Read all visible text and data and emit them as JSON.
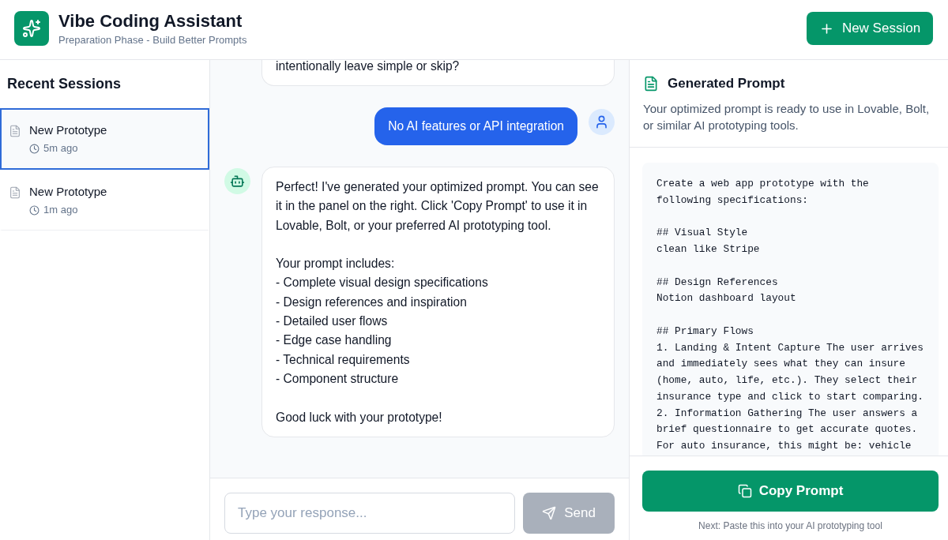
{
  "header": {
    "title": "Vibe Coding Assistant",
    "subtitle": "Preparation Phase - Build Better Prompts",
    "new_session_button": "New Session"
  },
  "sidebar": {
    "heading": "Recent Sessions",
    "sessions": [
      {
        "title": "New Prototype",
        "time": "5m ago",
        "selected": true
      },
      {
        "title": "New Prototype",
        "time": "1m ago",
        "selected": false
      }
    ]
  },
  "chat": {
    "messages": [
      {
        "kind": "assistant",
        "clipped": true,
        "text": "intentionally leave simple or skip?"
      },
      {
        "kind": "user",
        "text": "No AI features or API integration"
      },
      {
        "kind": "assistant",
        "text": "Perfect! I've generated your optimized prompt. You can see it in the panel on the right. Click 'Copy Prompt' to use it in Lovable, Bolt, or your preferred AI prototyping tool.\n\nYour prompt includes:\n- Complete visual design specifications\n- Design references and inspiration\n- Detailed user flows\n- Edge case handling\n- Technical requirements\n- Component structure\n\nGood luck with your prototype!"
      }
    ],
    "input": {
      "placeholder": "Type your response..."
    },
    "send_button": {
      "label": "Send",
      "disabled": true
    }
  },
  "prompt_panel": {
    "title": "Generated Prompt",
    "description": "Your optimized prompt is ready to use in Lovable, Bolt, or similar AI prototyping tools.",
    "prompt": "Create a web app prototype with the\nfollowing specifications:\n\n## Visual Style\nclean like Stripe\n\n## Design References\nNotion dashboard layout\n\n## Primary Flows\n1. Landing & Intent Capture The user arrives\nand immediately sees what they can insure\n(home, auto, life, etc.). They select their\ninsurance type and click to start comparing.\n2. Information Gathering The user answers a\nbrief questionnaire to get accurate quotes.\nFor auto insurance, this might be: vehicle",
    "copy_button": "Copy Prompt",
    "hint": "Next: Paste this into your AI prototyping tool"
  }
}
